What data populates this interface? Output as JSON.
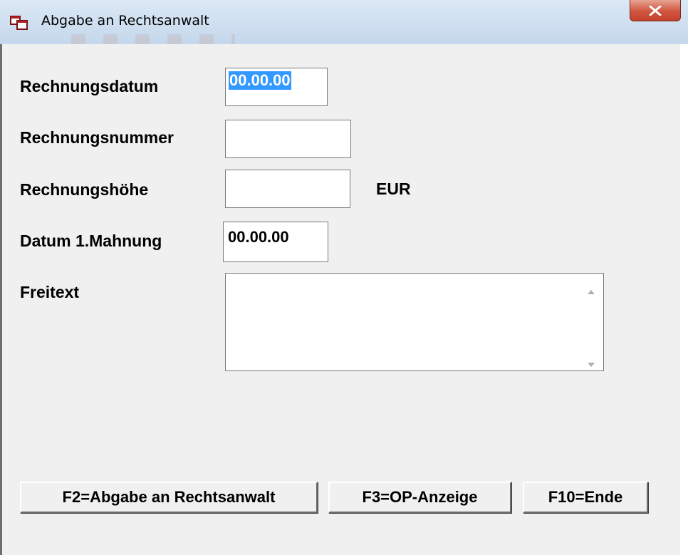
{
  "window": {
    "title": "Abgabe an Rechtsanwalt",
    "app_icon": "window-app-icon",
    "close_icon": "close-icon"
  },
  "form": {
    "rechnungsdatum": {
      "label": "Rechnungsdatum",
      "value": "00.00.00"
    },
    "rechnungsnummer": {
      "label": "Rechnungsnummer",
      "value": ""
    },
    "rechnungshoehe": {
      "label": "Rechnungshöhe",
      "value": "",
      "unit": "EUR"
    },
    "datum_mahnung": {
      "label": "Datum 1.Mahnung",
      "value": "00.00.00"
    },
    "freitext": {
      "label": "Freitext",
      "value": ""
    }
  },
  "buttons": {
    "f2": "F2=Abgabe an Rechtsanwalt",
    "f3": "F3=OP-Anzeige",
    "f10": "F10=Ende"
  },
  "colors": {
    "selection": "#3399ff",
    "close_button": "#c4412c",
    "background": "#f0f0f0"
  }
}
